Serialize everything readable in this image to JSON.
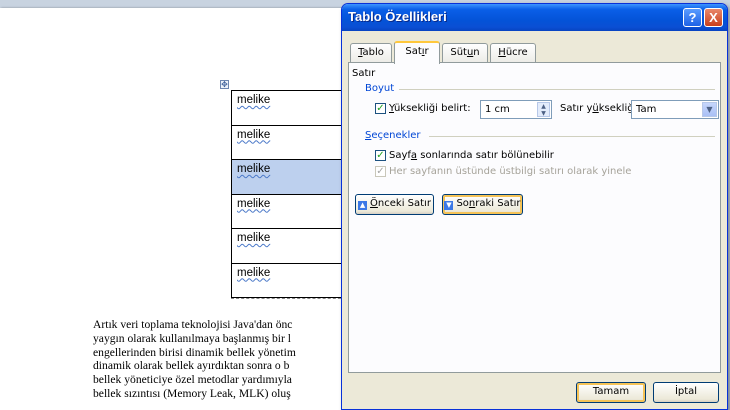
{
  "document": {
    "table_cells": [
      "melike",
      "melike",
      "melike",
      "melike",
      "melike",
      "melike"
    ],
    "paragraph_lines": [
      "Artık veri toplama teknolojisi Java'dan önc",
      "yaygın olarak kullanılmaya başlanmış bir l",
      "engellerinden birisi dinamik bellek yönetim",
      "dinamik olarak bellek ayırdıktan sonra o b",
      "bellek yöneticiye özel metodlar yardımıyla",
      "bellek sızıntısı (Memory Leak, MLK) oluş"
    ]
  },
  "dialog": {
    "title": "Tablo Özellikleri",
    "help_label": "?",
    "close_label": "X",
    "tabs": [
      {
        "pre": "",
        "u": "T",
        "post": "ablo"
      },
      {
        "pre": "Sat",
        "u": "ı",
        "post": "r"
      },
      {
        "pre": "Süt",
        "u": "u",
        "post": "n"
      },
      {
        "pre": "",
        "u": "H",
        "post": "ücre"
      }
    ],
    "section_title": "Satır",
    "size_group": "Boyut",
    "specify_height": {
      "pre": "",
      "u": "Y",
      "post": "üksekliği belirt:",
      "checked": true
    },
    "height_value": "1 cm",
    "row_height_label": {
      "pre": "Satır y",
      "u": "ü",
      "post": "ksekliği:"
    },
    "row_height_value": "Tam",
    "options_group": {
      "pre": "",
      "u": "S",
      "post": "eçenekler"
    },
    "allow_break": {
      "pre": "Sayf",
      "u": "a",
      "post": " sonlarında satır bölünebilir",
      "checked": true
    },
    "repeat_header": {
      "text": "Her sayfanın üstünde üstbilgi satırı olarak yinele",
      "checked": true
    },
    "prev_row": {
      "pre": "",
      "u": "Ö",
      "post": "nceki Satır"
    },
    "next_row": {
      "pre": "So",
      "u": "n",
      "post": "raki Satır"
    },
    "ok_label": "Tamam",
    "cancel_label": "İptal"
  }
}
